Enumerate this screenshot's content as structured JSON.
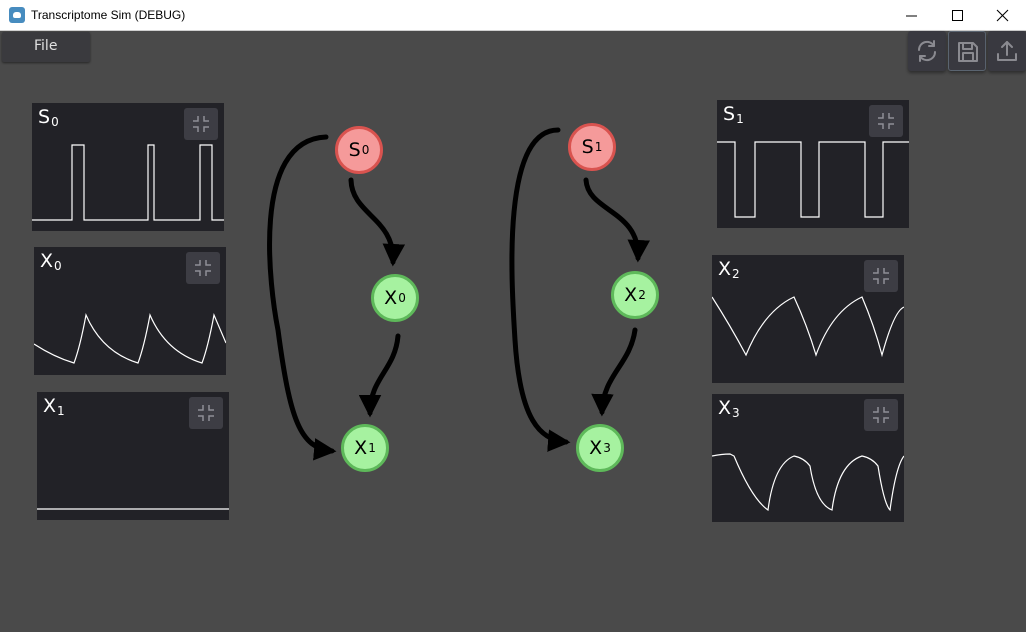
{
  "window": {
    "title": "Transcriptome Sim (DEBUG)",
    "controls": [
      "minimize-icon",
      "maximize-icon",
      "close-icon"
    ]
  },
  "menu": {
    "file_label": "File"
  },
  "toolbar": {
    "icons": [
      "refresh-icon",
      "save-icon",
      "export-icon"
    ]
  },
  "panels": [
    {
      "base": "S",
      "sub": "0",
      "icon": "collapse-icon"
    },
    {
      "base": "X",
      "sub": "0",
      "icon": "collapse-icon"
    },
    {
      "base": "X",
      "sub": "1",
      "icon": "collapse-icon"
    },
    {
      "base": "S",
      "sub": "1",
      "icon": "collapse-icon"
    },
    {
      "base": "X",
      "sub": "2",
      "icon": "collapse-icon"
    },
    {
      "base": "X",
      "sub": "3",
      "icon": "collapse-icon"
    }
  ],
  "nodes": [
    {
      "base": "S",
      "sub": "0",
      "kind": "source"
    },
    {
      "base": "X",
      "sub": "0",
      "kind": "species"
    },
    {
      "base": "X",
      "sub": "1",
      "kind": "species"
    },
    {
      "base": "S",
      "sub": "1",
      "kind": "source"
    },
    {
      "base": "X",
      "sub": "2",
      "kind": "species"
    },
    {
      "base": "X",
      "sub": "3",
      "kind": "species"
    }
  ],
  "edges": [
    {
      "from": "S0",
      "to": "X0"
    },
    {
      "from": "X0",
      "to": "X1"
    },
    {
      "from": "S0",
      "to": "X1"
    },
    {
      "from": "S1",
      "to": "X2"
    },
    {
      "from": "X2",
      "to": "X3"
    },
    {
      "from": "S1",
      "to": "X3"
    }
  ],
  "colors": {
    "background": "#4a4a4a",
    "panel": "#222227",
    "source_fill": "#f59a9a",
    "source_border": "#d9534f",
    "species_fill": "#a6f2a0",
    "species_border": "#5eb95a",
    "edge": "#000000",
    "trace": "#ffffff"
  }
}
